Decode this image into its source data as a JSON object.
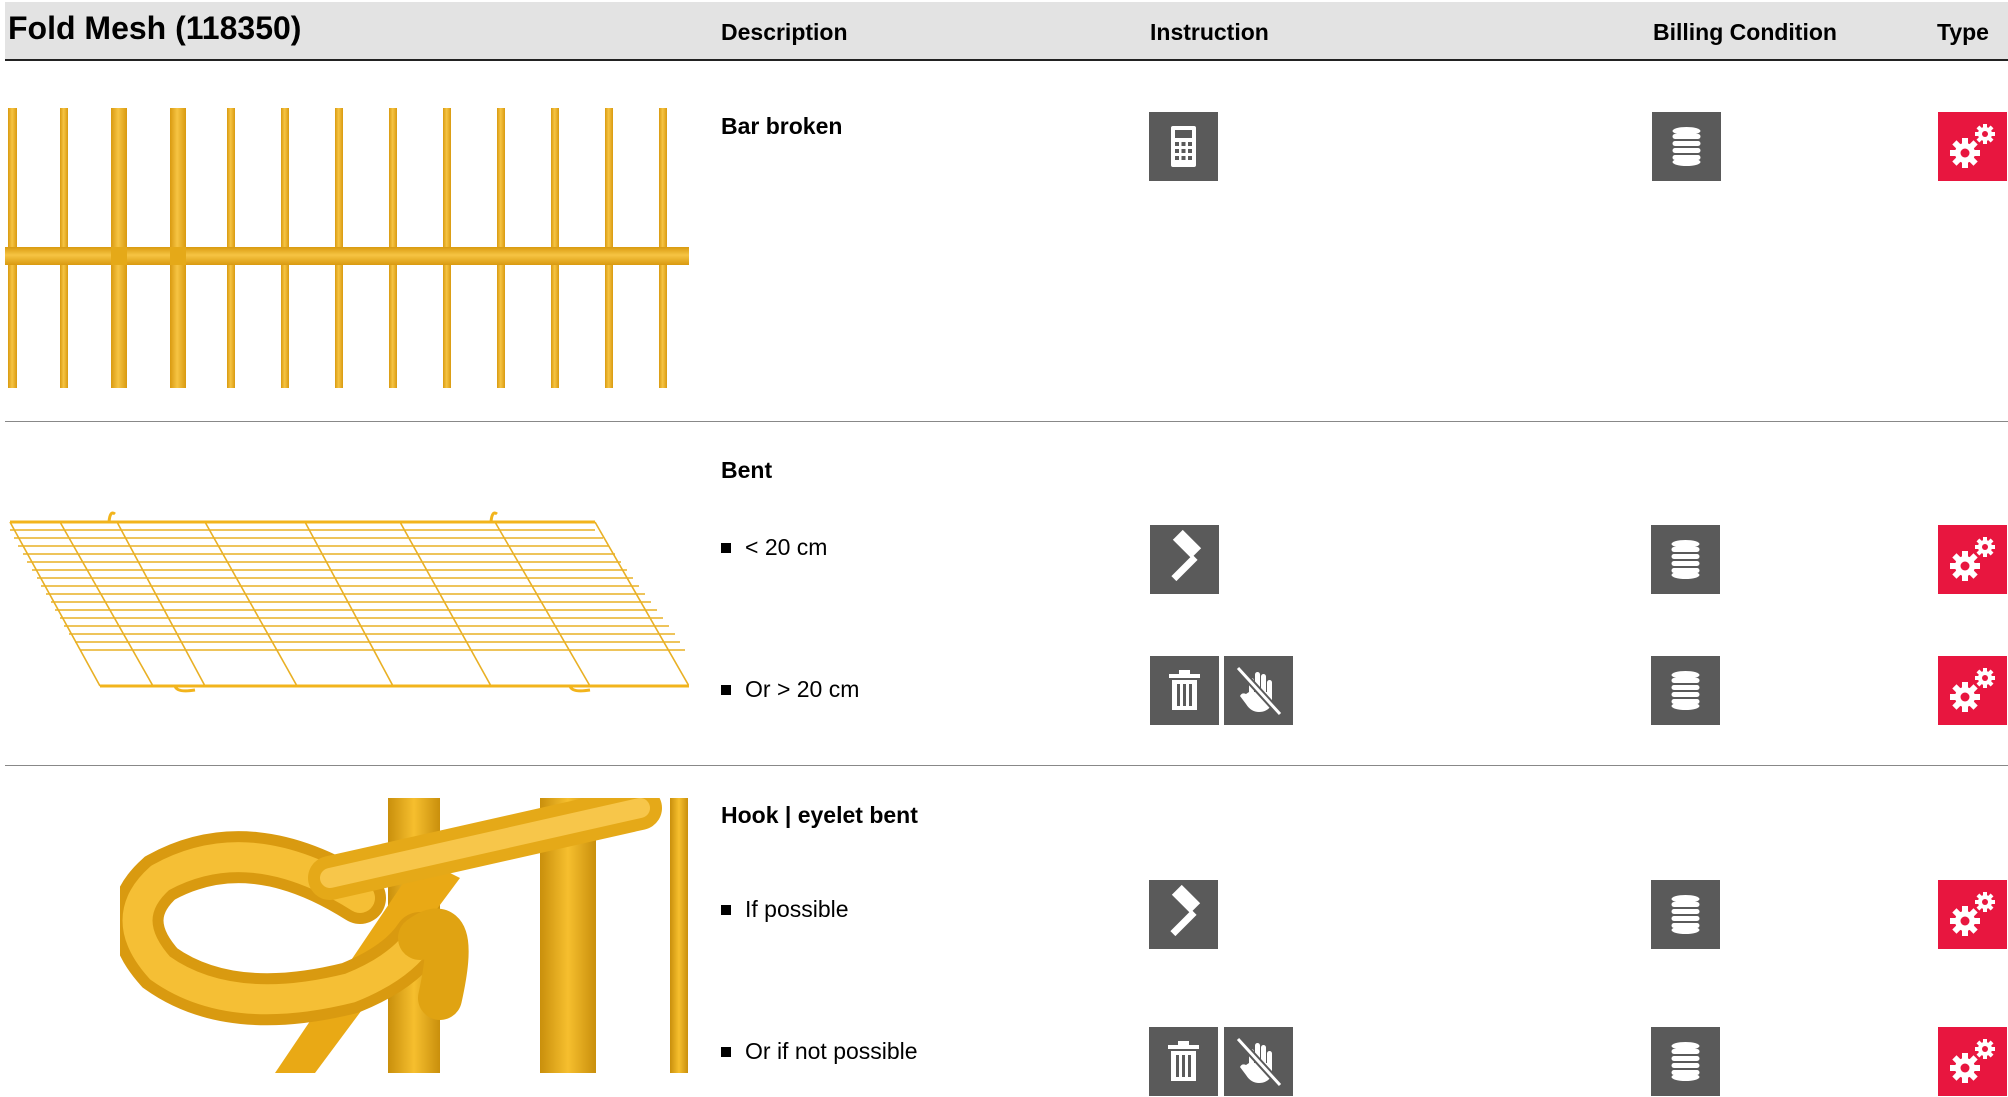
{
  "header": {
    "title": "Fold Mesh (118350)",
    "columns": {
      "description": "Description",
      "instruction": "Instruction",
      "billing": "Billing Condition",
      "type": "Type"
    }
  },
  "sections": [
    {
      "title": "Bar broken",
      "rows": [
        {
          "bullet": "",
          "instruction_icons": [
            "calculator-icon"
          ],
          "billing_icon": "coin-stack-icon",
          "type_icon": "gears-icon"
        }
      ]
    },
    {
      "title": "Bent",
      "rows": [
        {
          "bullet": "< 20 cm",
          "instruction_icons": [
            "hammer-icon"
          ],
          "billing_icon": "coin-stack-icon",
          "type_icon": "gears-icon"
        },
        {
          "bullet": "Or > 20 cm",
          "instruction_icons": [
            "trash-icon",
            "no-hand-icon"
          ],
          "billing_icon": "coin-stack-icon",
          "type_icon": "gears-icon"
        }
      ]
    },
    {
      "title": "Hook | eyelet bent",
      "rows": [
        {
          "bullet": "If possible",
          "instruction_icons": [
            "hammer-icon"
          ],
          "billing_icon": "coin-stack-icon",
          "type_icon": "gears-icon"
        },
        {
          "bullet": "Or if not possible",
          "instruction_icons": [
            "trash-icon",
            "no-hand-icon"
          ],
          "billing_icon": "coin-stack-icon",
          "type_icon": "gears-icon"
        }
      ]
    }
  ],
  "colors": {
    "header_bg": "#e3e3e3",
    "icon_gray": "#5a5a5a",
    "icon_red": "#e8163f",
    "mesh_yellow": "#f2b41c"
  }
}
